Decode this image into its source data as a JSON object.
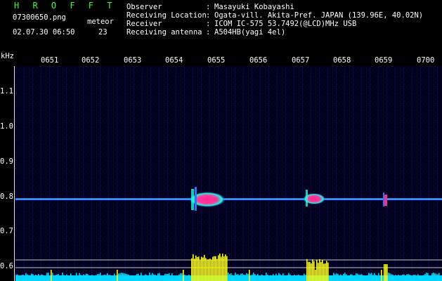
{
  "header": {
    "title": "H R O F F T",
    "filename": "07300650.png",
    "datetime": "02.07.30 06:50",
    "meteor_label": "meteor",
    "meteor_count": "23"
  },
  "info": [
    {
      "label": "Observer",
      "value": "Masayuki Kobayashi"
    },
    {
      "label": "Receiving Location",
      "value": "Ogata-vill. Akita-Pref. JAPAN (139.96E, 40.02N)"
    },
    {
      "label": "Receiver",
      "value": "ICOM IC-575 53.7492(@LCD)MHz USB"
    },
    {
      "label": "Receiving antenna",
      "value": "A504HB(yagi 4el)"
    }
  ],
  "colon": ":",
  "spectrogram": {
    "y_unit": "kHz",
    "y_ticks": [
      "1.1",
      "1.0",
      "0.9",
      "0.8",
      "0.7",
      "0.6"
    ],
    "x_ticks": [
      "0651",
      "0652",
      "0653",
      "0654",
      "0655",
      "0656",
      "0657",
      "0658",
      "0659",
      "0700"
    ],
    "carrier_khz": 0.79,
    "meteor_echoes": [
      "06:54:40",
      "06:57:20",
      "06:59:10"
    ],
    "colors": {
      "background": "#000022",
      "carrier": "#2a7cff",
      "echo_core": "#ff2a8a",
      "echo_edge": "#19ffd8",
      "level": "#ffff00",
      "level_base": "#00d0ff"
    }
  }
}
